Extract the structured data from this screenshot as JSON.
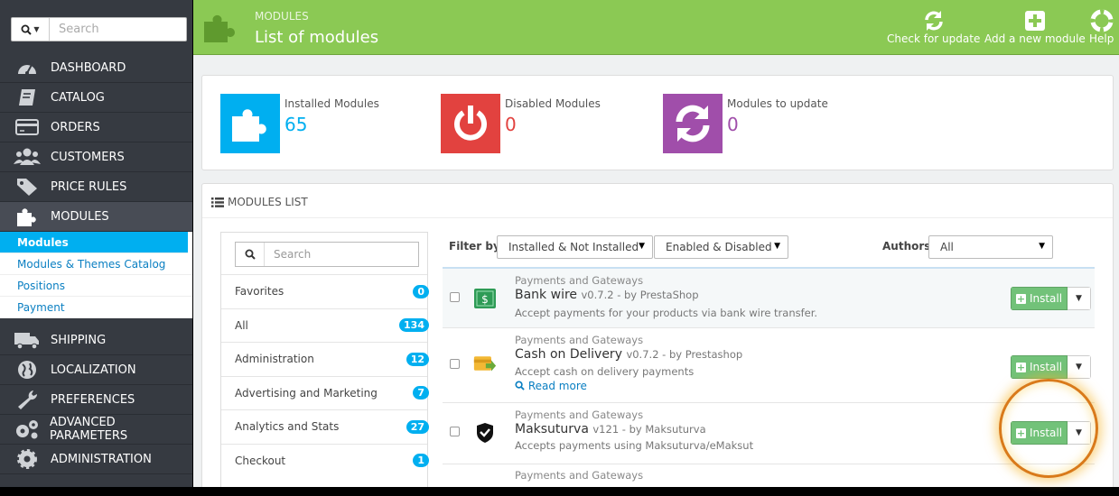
{
  "sidebar": {
    "search_placeholder": "Search",
    "menu_top": [
      {
        "label": "DASHBOARD"
      },
      {
        "label": "CATALOG"
      },
      {
        "label": "ORDERS"
      },
      {
        "label": "CUSTOMERS"
      },
      {
        "label": "PRICE RULES"
      },
      {
        "label": "MODULES",
        "active": true
      }
    ],
    "submenu": [
      {
        "label": "Modules",
        "active": true
      },
      {
        "label": "Modules & Themes Catalog"
      },
      {
        "label": "Positions"
      },
      {
        "label": "Payment"
      }
    ],
    "menu_bottom": [
      {
        "label": "SHIPPING"
      },
      {
        "label": "LOCALIZATION"
      },
      {
        "label": "PREFERENCES"
      },
      {
        "label": "ADVANCED PARAMETERS"
      },
      {
        "label": "ADMINISTRATION"
      }
    ]
  },
  "header": {
    "breadcrumb": "MODULES",
    "title": "List of modules",
    "toolbar": {
      "check_update": "Check for update",
      "add_module": "Add a new module",
      "help": "Help"
    }
  },
  "kpis": [
    {
      "label": "Installed Modules",
      "value": "65",
      "color": "#00aff0"
    },
    {
      "label": "Disabled Modules",
      "value": "0",
      "color": "#e2423f"
    },
    {
      "label": "Modules to update",
      "value": "0",
      "color": "#a04eaa"
    }
  ],
  "modules_list": {
    "heading": "MODULES LIST",
    "category_search_placeholder": "Search",
    "categories": [
      {
        "label": "Favorites",
        "count": "0"
      },
      {
        "label": "All",
        "count": "134"
      },
      {
        "label": "Administration",
        "count": "12"
      },
      {
        "label": "Advertising and Marketing",
        "count": "7"
      },
      {
        "label": "Analytics and Stats",
        "count": "27"
      },
      {
        "label": "Checkout",
        "count": "1"
      }
    ],
    "filter": {
      "label": "Filter by",
      "install_state": "Installed & Not Installed",
      "enable_state": "Enabled & Disabled",
      "authors_label": "Authors",
      "authors_value": "All"
    },
    "modules": [
      {
        "category": "Payments and Gateways",
        "name": "Bank wire",
        "meta": "v0.7.2 - by PrestaShop",
        "description": "Accept payments for your products via bank wire transfer.",
        "read_more": "",
        "action": "Install"
      },
      {
        "category": "Payments and Gateways",
        "name": "Cash on Delivery",
        "meta": "v0.7.2 - by Prestashop",
        "description": "Accept cash on delivery payments",
        "read_more": "Read more",
        "action": "Install"
      },
      {
        "category": "Payments and Gateways",
        "name": "Maksuturva",
        "meta": "v121 - by Maksuturva",
        "description": "Accepts payments using Maksuturva/eMaksut",
        "read_more": "",
        "action": "Install"
      },
      {
        "category": "Payments and Gateways"
      }
    ]
  },
  "colors": {
    "header_green": "#8bc954",
    "sidebar_dark": "#363a41",
    "accent_blue": "#00aff0",
    "install_green": "#72c279",
    "highlight_orange": "#d97a1a"
  }
}
